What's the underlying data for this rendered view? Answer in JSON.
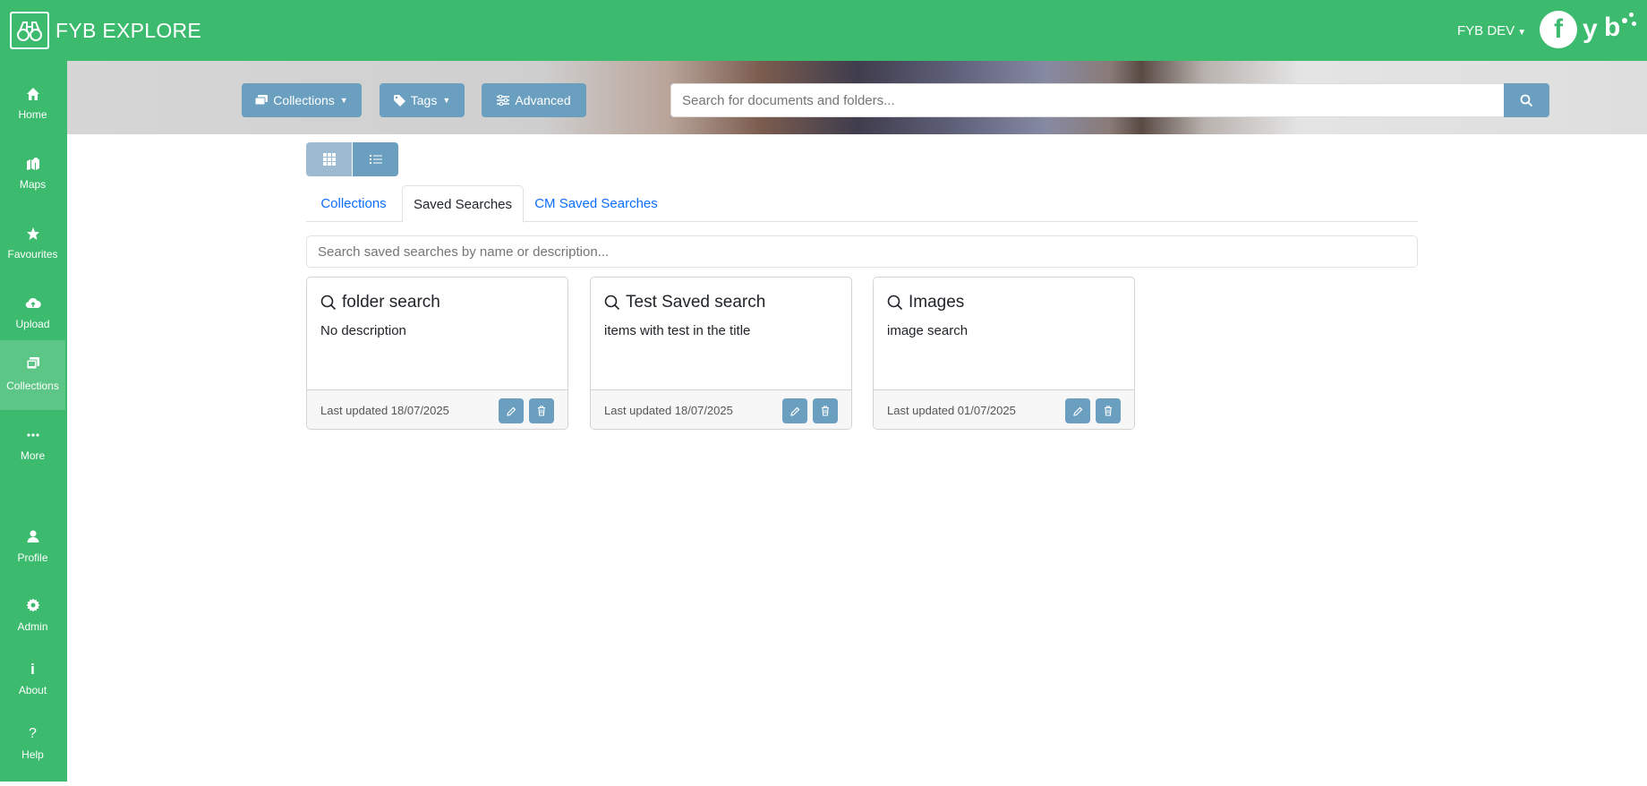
{
  "app": {
    "title": "FYB EXPLORE",
    "user": "FYB DEV",
    "brand_letters": [
      "f",
      "y",
      "b"
    ],
    "accent_color": "#3cba6e",
    "button_color": "#6a9fc0"
  },
  "sidebar": {
    "items": [
      {
        "label": "Home",
        "icon": "home-icon"
      },
      {
        "label": "Maps",
        "icon": "map-icon"
      },
      {
        "label": "Favourites",
        "icon": "star-icon"
      },
      {
        "label": "Upload",
        "icon": "cloud-upload-icon"
      },
      {
        "label": "Collections",
        "icon": "collections-icon",
        "active": true
      },
      {
        "label": "More",
        "icon": "more-icon"
      },
      {
        "label": "Profile",
        "icon": "user-icon"
      },
      {
        "label": "Admin",
        "icon": "gear-icon"
      },
      {
        "label": "About",
        "icon": "info-icon"
      },
      {
        "label": "Help",
        "icon": "question-icon"
      }
    ]
  },
  "toolbar": {
    "collections_label": "Collections",
    "tags_label": "Tags",
    "advanced_label": "Advanced",
    "search_placeholder": "Search for documents and folders..."
  },
  "tabs": [
    {
      "label": "Collections"
    },
    {
      "label": "Saved Searches",
      "active": true
    },
    {
      "label": "CM Saved Searches"
    }
  ],
  "filter": {
    "placeholder": "Search saved searches by name or description..."
  },
  "cards": [
    {
      "title": "folder search",
      "description": "No description",
      "updated": "Last updated 18/07/2025"
    },
    {
      "title": "Test Saved search",
      "description": "items with test in the title",
      "updated": "Last updated 18/07/2025"
    },
    {
      "title": "Images",
      "description": "image search",
      "updated": "Last updated 01/07/2025"
    }
  ]
}
